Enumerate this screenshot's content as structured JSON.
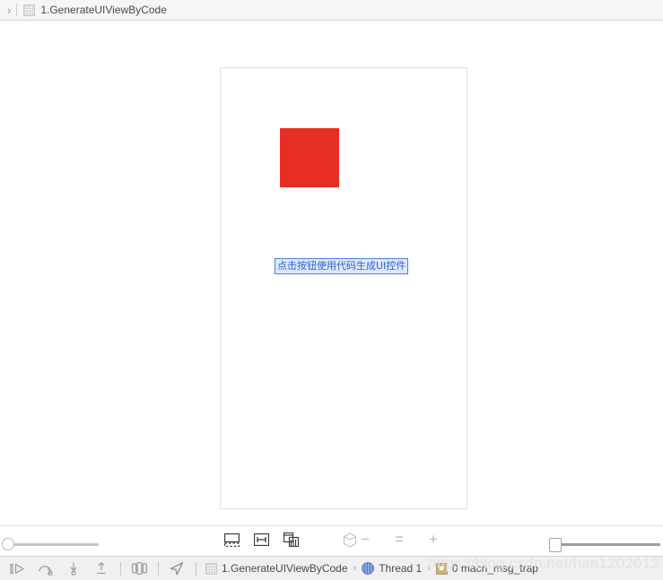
{
  "jump_bar": {
    "chevron": "›",
    "file_icon": "storyboard-file-icon",
    "title": "1.GenerateUIViewByCode"
  },
  "canvas": {
    "device_preview": {
      "red_view": {
        "name": "red-uiview",
        "color": "#e62e25"
      },
      "label": {
        "text": "点击按钮使用代码生成UI控件",
        "text_color": "#2d63d8",
        "selection_fill": "#dfe7fb",
        "selection_border": "#4a7fe0"
      }
    }
  },
  "canvas_toolbar": {
    "left_slider": {
      "name": "canvas-zoom-slider",
      "value": 0
    },
    "buttons": [
      {
        "name": "update-frames-button",
        "icon": "update-frames-icon"
      },
      {
        "name": "align-button",
        "icon": "align-icon"
      },
      {
        "name": "embed-in-button",
        "icon": "embed-in-icon"
      },
      {
        "name": "view-as-3d-button",
        "icon": "cube-icon"
      }
    ],
    "zoom_controls": [
      {
        "name": "zoom-out-button",
        "label": "−"
      },
      {
        "name": "zoom-actual-size-button",
        "label": "="
      },
      {
        "name": "zoom-in-button",
        "label": "+"
      }
    ],
    "right_slider": {
      "name": "device-scale-slider",
      "value": 0
    }
  },
  "debug_bar": {
    "controls": [
      {
        "name": "continue-button",
        "icon": "continue-icon"
      },
      {
        "name": "step-over-button",
        "icon": "step-over-icon"
      },
      {
        "name": "step-into-button",
        "icon": "step-into-icon"
      },
      {
        "name": "step-out-button",
        "icon": "step-out-icon"
      },
      {
        "name": "debug-view-hierarchy-button",
        "icon": "view-hierarchy-icon"
      },
      {
        "name": "simulate-location-button",
        "icon": "location-arrow-icon"
      }
    ],
    "breadcrumb": {
      "process_icon": "storyboard-file-icon",
      "process": "1.GenerateUIViewByCode",
      "arrow": "›",
      "thread_icon": "thread-icon",
      "thread": "Thread 1",
      "frame_icon": "stack-frame-icon",
      "frame": "0 mach_msg_trap"
    }
  },
  "watermark": {
    "text": "https://blog.csdn.net/han1202012"
  }
}
